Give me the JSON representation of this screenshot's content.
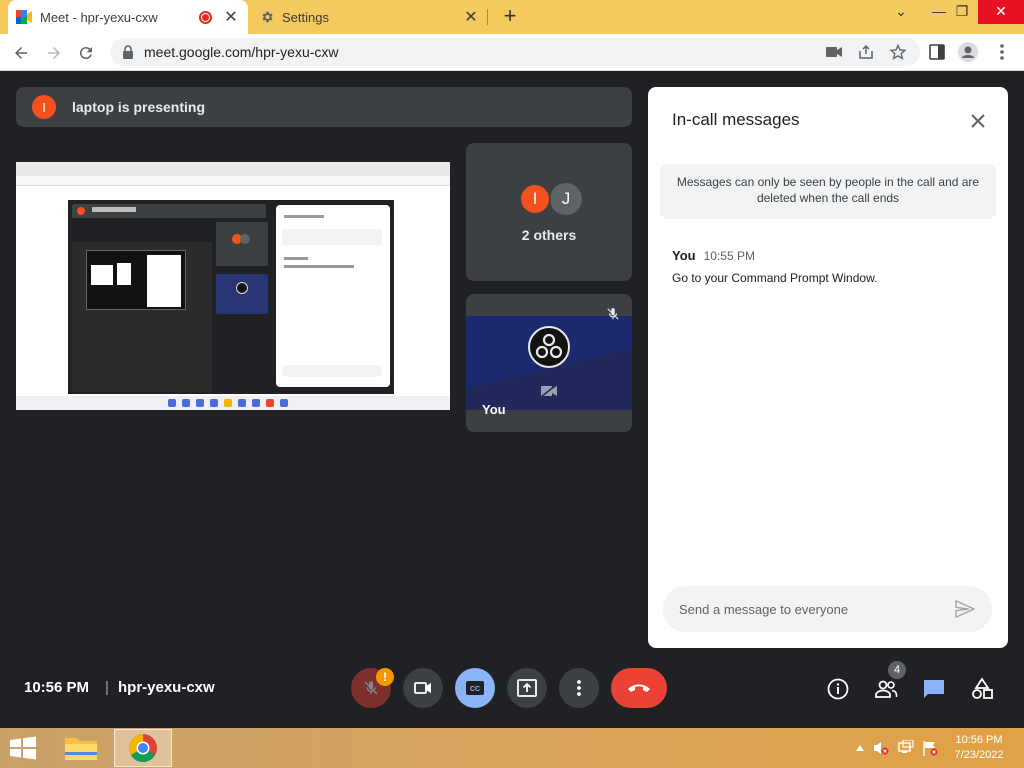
{
  "browser": {
    "tabs": [
      {
        "title": "Meet - hpr-yexu-cxw",
        "active": true
      },
      {
        "title": "Settings",
        "active": false
      }
    ],
    "url": "meet.google.com/hpr-yexu-cxw"
  },
  "meet": {
    "presenter_initial": "I",
    "presenting_text": "laptop is presenting",
    "others": {
      "initials": [
        "I",
        "J"
      ],
      "label": "2 others"
    },
    "self_label": "You",
    "meeting_time": "10:56 PM",
    "separator": "|",
    "meeting_code": "hpr-yexu-cxw",
    "warning_badge": "!",
    "participant_count": "4",
    "colors": {
      "end_call": "#ea4335",
      "captions_on": "#8ab4f8",
      "presenter_avatar": "#f4511e",
      "chat_accent": "#1a73e8"
    }
  },
  "chat": {
    "title": "In-call messages",
    "notice": "Messages can only be seen by people in the call and are deleted when the call ends",
    "messages": [
      {
        "sender": "You",
        "time": "10:55 PM",
        "text": "Go to your Command Prompt Window."
      }
    ],
    "input_placeholder": "Send a message to everyone"
  },
  "taskbar": {
    "time": "10:56 PM",
    "date": "7/23/2022"
  }
}
